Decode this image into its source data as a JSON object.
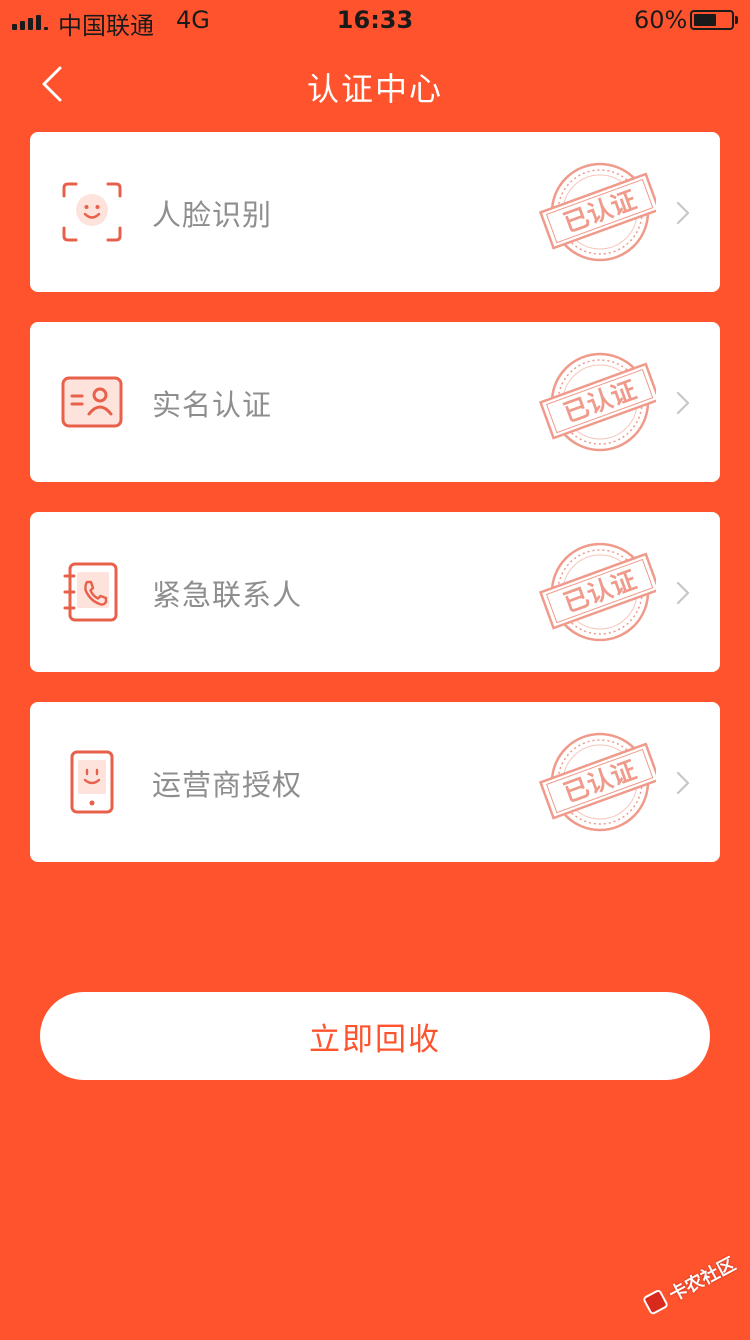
{
  "status_bar": {
    "carrier": "中国联通",
    "network": "4G",
    "time": "16:33",
    "battery_percent": "60%",
    "battery_level": 0.6
  },
  "nav": {
    "title": "认证中心",
    "back_icon": "chevron-left-icon"
  },
  "items": [
    {
      "label": "人脸识别",
      "icon": "face-scan-icon",
      "stamp": "已认证"
    },
    {
      "label": "实名认证",
      "icon": "id-card-icon",
      "stamp": "已认证"
    },
    {
      "label": "紧急联系人",
      "icon": "contact-book-icon",
      "stamp": "已认证"
    },
    {
      "label": "运营商授权",
      "icon": "mobile-phone-icon",
      "stamp": "已认证"
    }
  ],
  "action_button": {
    "label": "立即回收"
  },
  "watermark": {
    "text": "卡农社区"
  },
  "colors": {
    "background": "#ff532e",
    "card": "#ffffff",
    "label_text": "#8e8e8e",
    "icon": "#e8604a",
    "stamp": "#ef9a8a",
    "button_text": "#ff532e"
  }
}
